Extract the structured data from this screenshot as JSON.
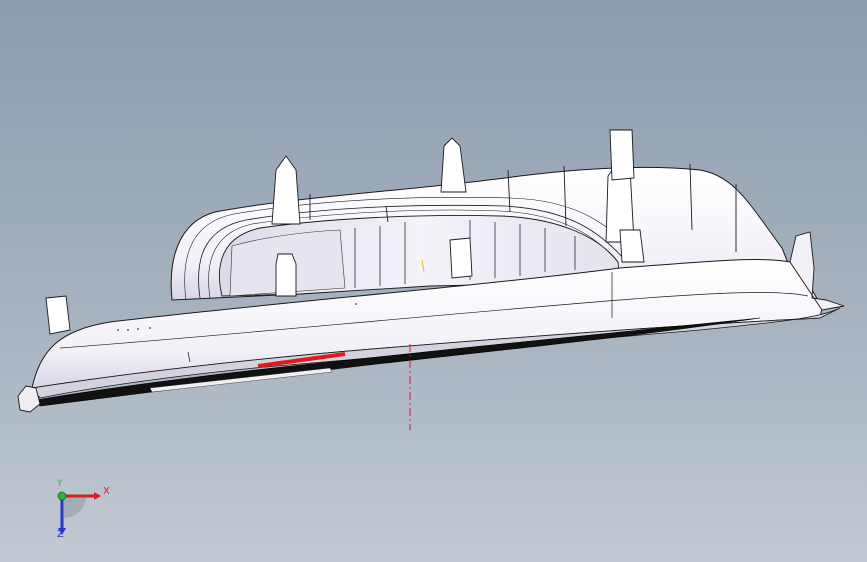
{
  "viewport": {
    "background_top": "#8c9cae",
    "background_bottom": "#c2cad3"
  },
  "model": {
    "body_color": "#ffffff",
    "edge_color": "#1a1a1a",
    "highlight_color": "#e01b1b",
    "centerline_color": "#c0282c"
  },
  "triad": {
    "x_label": "X",
    "y_label": "Y",
    "z_label": "Z",
    "x_color": "#d42020",
    "y_color": "#2cb53c",
    "z_color": "#2737c8"
  }
}
